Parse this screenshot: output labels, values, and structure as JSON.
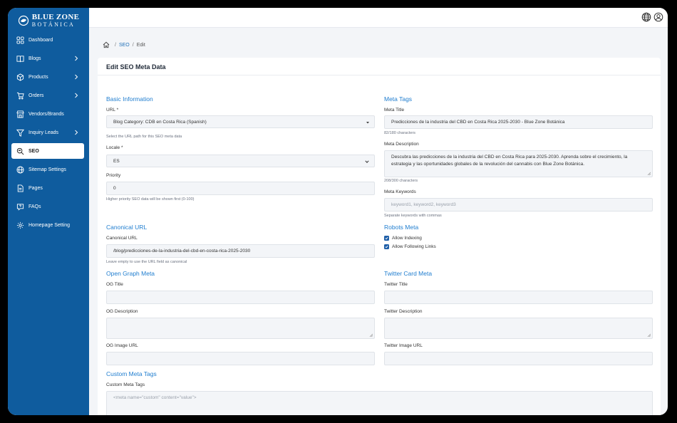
{
  "brand": {
    "line1": "BLUE ZONE",
    "line2": "BOTÁNICA",
    "logo_icon": "globe-leaf-icon"
  },
  "sidebar": {
    "items": [
      {
        "label": "Dashboard",
        "icon": "grid-icon"
      },
      {
        "label": "Blogs",
        "icon": "book-icon"
      },
      {
        "label": "Products",
        "icon": "box-icon"
      },
      {
        "label": "Orders",
        "icon": "cart-icon"
      },
      {
        "label": "Vendors/Brands",
        "icon": "store-icon"
      },
      {
        "label": "Inquiry Leads",
        "icon": "funnel-icon"
      },
      {
        "label": "SEO",
        "icon": "seo-search-icon",
        "active": true
      },
      {
        "label": "Sitemap Settings",
        "icon": "globe-icon"
      },
      {
        "label": "Pages",
        "icon": "page-icon"
      },
      {
        "label": "FAQs",
        "icon": "question-icon"
      },
      {
        "label": "Homepage Setting",
        "icon": "settings-icon"
      }
    ]
  },
  "topbar": {
    "language_icon": "globe-icon",
    "profile_icon": "user-icon"
  },
  "breadcrumb": {
    "home_icon": "home-icon",
    "seo": "SEO",
    "edit": "Edit"
  },
  "page": {
    "title": "Edit SEO Meta Data"
  },
  "basic": {
    "title": "Basic Information",
    "url_label": "URL *",
    "url_value": "Blog Category: CDB en Costa Rica (Spanish)",
    "url_help": "Select the URL path for this SEO meta data",
    "locale_label": "Locale *",
    "locale_value": "ES",
    "priority_label": "Priority",
    "priority_value": "0",
    "priority_help": "Higher priority SEO data will be shown first (0-100)"
  },
  "meta": {
    "title": "Meta Tags",
    "meta_title_label": "Meta Title",
    "meta_title_value": "Predicciones de la industria del CBD en Costa Rica 2025-2030 - Blue Zone Botánica",
    "meta_title_count": "82/180 characters",
    "meta_desc_label": "Meta Description",
    "meta_desc_line1": "Descubra las predicciones de la industria del CBD en Costa Rica para 2025-2030. Aprenda sobre el crecimiento, la",
    "meta_desc_line2": "estrategia y las oportunidades globales de la revolución del cannabis con Blue Zone Botánica.",
    "meta_desc_count": "208/300 characters",
    "keywords_label": "Meta Keywords",
    "keywords_placeholder": "keyword1, keyword2, keyword3",
    "keywords_help": "Separate keywords with commas"
  },
  "canonical": {
    "title": "Canonical URL",
    "label": "Canonical URL",
    "value": "/blog/predicciones-de-la-industria-del-cbd-en-costa-rica-2025-2030",
    "help": "Leave empty to use the URL field as canonical"
  },
  "robots": {
    "title": "Robots Meta",
    "allow_indexing": "Allow Indexing",
    "allow_following": "Allow Following Links"
  },
  "og": {
    "title": "Open Graph Meta",
    "title_label": "OG Title",
    "desc_label": "OG Description",
    "image_label": "OG Image URL"
  },
  "twitter": {
    "title": "Twitter Card Meta",
    "title_label": "Twitter Title",
    "desc_label": "Twitter Description",
    "image_label": "Twitter Image URL"
  },
  "custom": {
    "title": "Custom Meta Tags",
    "label": "Custom Meta Tags",
    "placeholder": "<meta name=\"custom\" content=\"value\">"
  },
  "colors": {
    "sidebar": "#0f5c9e",
    "accent": "#1f7dcf",
    "checkbox": "#1f5fa8"
  }
}
